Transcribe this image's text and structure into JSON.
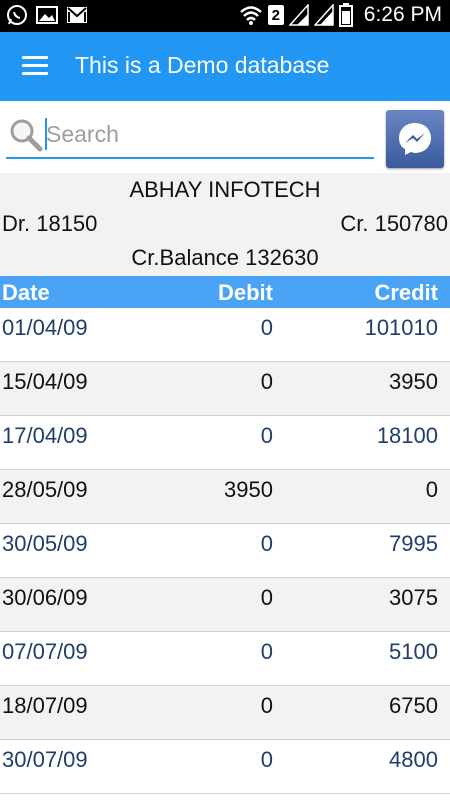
{
  "status_bar": {
    "time": "6:26 PM",
    "sim_badge": "2",
    "left_icons": [
      "whatsapp-icon",
      "image-icon",
      "gmail-icon"
    ],
    "right_icons": [
      "wifi-icon",
      "sim-badge",
      "signal-icon",
      "signal-icon",
      "battery-icon"
    ]
  },
  "app_bar": {
    "title": "This is a Demo database",
    "color": "#2196f3"
  },
  "search": {
    "placeholder": "Search",
    "value": ""
  },
  "account": {
    "name": "ABHAY INFOTECH",
    "debit_total": "Dr. 18150",
    "credit_total": "Cr. 150780",
    "balance": "Cr.Balance 132630"
  },
  "table": {
    "header_color": "#4aa3f5",
    "headers": {
      "date": "Date",
      "debit": "Debit",
      "credit": "Credit"
    },
    "rows": [
      {
        "date": "01/04/09",
        "debit": "0",
        "credit": "101010"
      },
      {
        "date": "15/04/09",
        "debit": "0",
        "credit": "3950"
      },
      {
        "date": "17/04/09",
        "debit": "0",
        "credit": "18100"
      },
      {
        "date": "28/05/09",
        "debit": "3950",
        "credit": "0"
      },
      {
        "date": "30/05/09",
        "debit": "0",
        "credit": "7995"
      },
      {
        "date": "30/06/09",
        "debit": "0",
        "credit": "3075"
      },
      {
        "date": "07/07/09",
        "debit": "0",
        "credit": "5100"
      },
      {
        "date": "18/07/09",
        "debit": "0",
        "credit": "6750"
      },
      {
        "date": "30/07/09",
        "debit": "0",
        "credit": "4800"
      }
    ]
  }
}
